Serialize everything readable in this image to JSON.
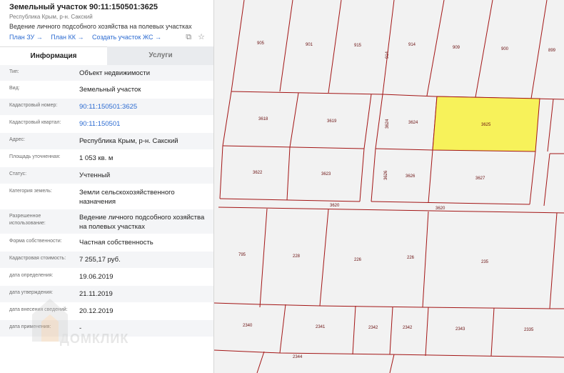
{
  "header": {
    "title": "Земельный участок 90:11:150501:3625",
    "region": "Республика Крым, р-н. Сакский",
    "purpose": "Ведение личного подсобного хозяйства на полевых участках",
    "links": [
      "План ЗУ →",
      "План КК →",
      "Создать участок ЖС →"
    ]
  },
  "tabs": {
    "info": "Информация",
    "services": "Услуги"
  },
  "rows": [
    {
      "label": "Тип:",
      "value": "Объект недвижимости"
    },
    {
      "label": "Вид:",
      "value": "Земельный участок"
    },
    {
      "label": "Кадастровый номер:",
      "value": "90:11:150501:3625"
    },
    {
      "label": "Кадастровый квартал:",
      "value": "90:11:150501"
    },
    {
      "label": "Адрес:",
      "value": "Республика Крым, р-н. Сакский"
    },
    {
      "label": "Площадь уточненная:",
      "value": "1 053 кв. м"
    },
    {
      "label": "Статус:",
      "value": "Учтенный"
    },
    {
      "label": "Категория земель:",
      "value": "Земли сельскохозяйственного назначения"
    },
    {
      "label": "Разрешенное использование:",
      "value": "Ведение личного подсобного хозяйства на полевых участках"
    },
    {
      "label": "Форма собственности:",
      "value": "Частная собственность"
    },
    {
      "label": "Кадастровая стоимость:",
      "value": "7 255,17 руб."
    },
    {
      "label": "дата определения:",
      "value": "19.06.2019"
    },
    {
      "label": "дата утверждения:",
      "value": "21.11.2019"
    },
    {
      "label": "дата внесения сведений:",
      "value": "20.12.2019"
    },
    {
      "label": "дата применения:",
      "value": "-"
    }
  ],
  "watermark": "ДОМКЛИК",
  "map": {
    "parcels": [
      "905",
      "901",
      "915",
      "914",
      "914",
      "909",
      "900",
      "899",
      "3618",
      "3619",
      "3624",
      "3624",
      "3625",
      "3622",
      "3623",
      "3626",
      "3626",
      "3627",
      "3620",
      "3620",
      "795",
      "228",
      "226",
      "226",
      "235",
      "2340",
      "2341",
      "2342",
      "2342",
      "2343",
      "2335",
      "2344"
    ],
    "colors": {
      "line": "#a31515",
      "highlight": "#f7f25a",
      "background": "#f2f2f2",
      "link": "#2c6bd1"
    }
  }
}
